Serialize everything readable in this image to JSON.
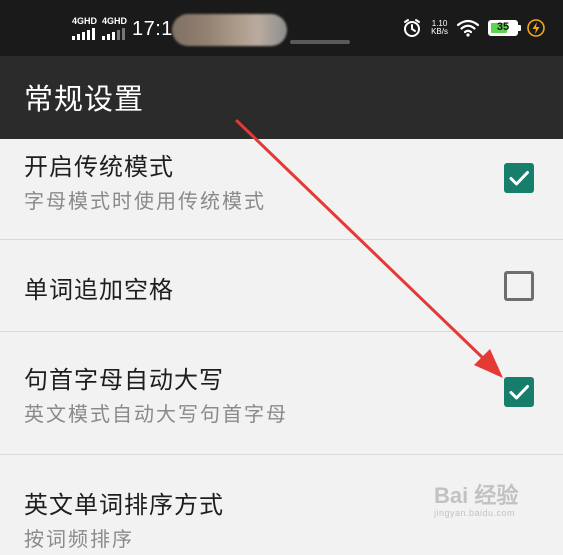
{
  "status_bar": {
    "signal_1_label": "4GHD",
    "signal_2_label": "4GHD",
    "time": "17:1",
    "net_speed_value": "1.10",
    "net_speed_unit": "KB/s",
    "battery_level": "35",
    "icons": [
      "alarm-icon",
      "wifi-icon",
      "battery-icon",
      "charging-icon"
    ]
  },
  "app_bar": {
    "title": "常规设置"
  },
  "settings": [
    {
      "title": "开启传统模式",
      "summary": "字母模式时使用传统模式",
      "checked": true
    },
    {
      "title": "单词追加空格",
      "summary": "",
      "checked": false
    },
    {
      "title": "句首字母自动大写",
      "summary": "英文模式自动大写句首字母",
      "checked": true
    },
    {
      "title": "英文单词排序方式",
      "summary": "按词频排序",
      "checked": null
    }
  ],
  "watermark": {
    "main": "Bai 经验",
    "sub": "jingyan.baidu.com"
  },
  "colors": {
    "status_bar_bg": "#1a1a1a",
    "app_bar_bg": "#2b2b2b",
    "list_bg": "#f2f2f2",
    "checkbox_checked": "#187e6c",
    "battery_fill": "#5ed34f",
    "annotation_arrow": "#e53935"
  }
}
